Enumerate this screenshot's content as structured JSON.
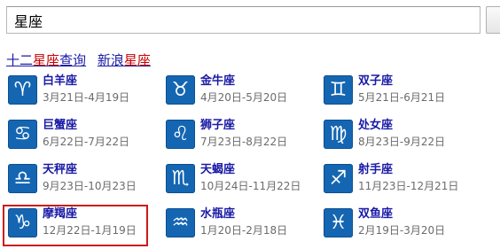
{
  "search": {
    "value": "星座"
  },
  "title": {
    "link1_a": "十二",
    "link1_b": "星座",
    "link1_c": "查询",
    "link2_a": "新浪",
    "link2_b": "星座"
  },
  "signs": [
    {
      "name": "白羊座",
      "dates": "3月21日-4月19日",
      "icon": "aries-icon",
      "glyph": "♈"
    },
    {
      "name": "金牛座",
      "dates": "4月20日-5月20日",
      "icon": "taurus-icon",
      "glyph": "♉"
    },
    {
      "name": "双子座",
      "dates": "5月21日-6月21日",
      "icon": "gemini-icon",
      "glyph": "♊"
    },
    {
      "name": "巨蟹座",
      "dates": "6月22日-7月22日",
      "icon": "cancer-icon",
      "glyph": "♋"
    },
    {
      "name": "狮子座",
      "dates": "7月23日-8月22日",
      "icon": "leo-icon",
      "glyph": "♌"
    },
    {
      "name": "处女座",
      "dates": "8月23日-9月22日",
      "icon": "virgo-icon",
      "glyph": "♍"
    },
    {
      "name": "天秤座",
      "dates": "9月23日-10月23日",
      "icon": "libra-icon",
      "glyph": "♎"
    },
    {
      "name": "天蝎座",
      "dates": "10月24日-11月22日",
      "icon": "scorpio-icon",
      "glyph": "♏"
    },
    {
      "name": "射手座",
      "dates": "11月23日-12月21日",
      "icon": "sagittarius-icon",
      "glyph": "♐"
    },
    {
      "name": "摩羯座",
      "dates": "12月22日-1月19日",
      "icon": "capricorn-icon",
      "glyph": "♑"
    },
    {
      "name": "水瓶座",
      "dates": "1月20日-2月18日",
      "icon": "aquarius-icon",
      "glyph": "♒"
    },
    {
      "name": "双鱼座",
      "dates": "2月19日-3月20日",
      "icon": "pisces-icon",
      "glyph": "♓"
    }
  ],
  "colors": {
    "icon_bg": "#1566b2",
    "link": "#1a1aa6",
    "highlight_text": "#cc0000",
    "selection_border": "#cc1a1a",
    "dates": "#6b6b6b"
  }
}
